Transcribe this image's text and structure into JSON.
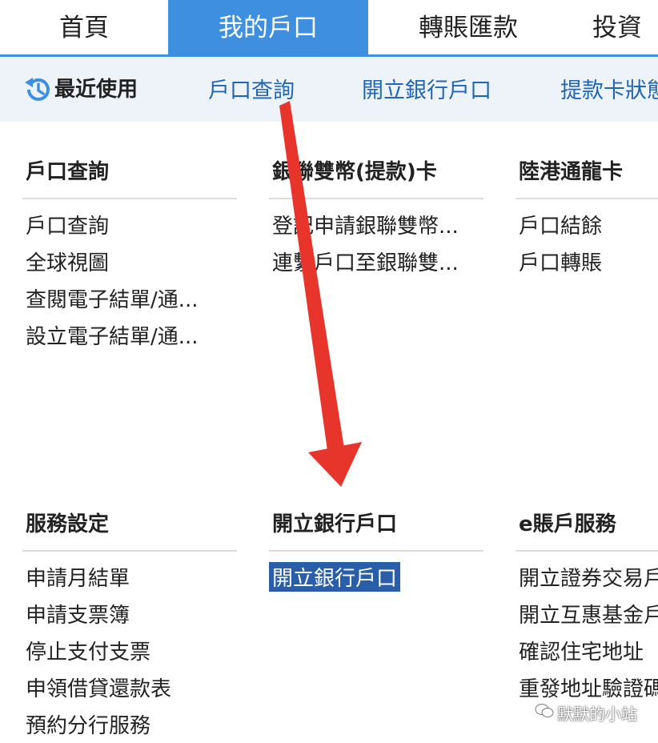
{
  "tabs": [
    {
      "label": "首頁"
    },
    {
      "label": "我的戶口"
    },
    {
      "label": "轉賬匯款"
    },
    {
      "label": "投資"
    }
  ],
  "recent": {
    "title": "最近使用",
    "links": [
      {
        "label": "戶口查詢"
      },
      {
        "label": "開立銀行戶口"
      },
      {
        "label": "提款卡狀態"
      }
    ]
  },
  "sections": [
    {
      "title": "戶口查詢",
      "items": [
        "戶口查詢",
        "全球視圖",
        "查閱電子結單/通...",
        "設立電子結單/通..."
      ]
    },
    {
      "title": "銀聯雙幣(提款)卡",
      "items": [
        "登記申請銀聯雙幣...",
        "連繫戶口至銀聯雙..."
      ]
    },
    {
      "title": "陸港通龍卡",
      "items": [
        "戶口結餘",
        "戶口轉賬"
      ]
    },
    {
      "title": "服務設定",
      "items": [
        "申請月結單",
        "申請支票簿",
        "停止支付支票",
        "申領借貸還款表",
        "預約分行服務"
      ]
    },
    {
      "title": "開立銀行戶口",
      "items": [
        "開立銀行戶口"
      ]
    },
    {
      "title": "e賬戶服務",
      "items": [
        "開立證券交易戶",
        "開立互惠基金戶",
        "確認住宅地址",
        "重發地址驗證碼"
      ]
    }
  ],
  "selected_item": "開立銀行戶口",
  "watermark": "默默的小站",
  "colors": {
    "accent": "#3f8fe0",
    "link": "#1f66b3",
    "arrow": "#e8352b",
    "highlight": "#2a5ea8"
  }
}
